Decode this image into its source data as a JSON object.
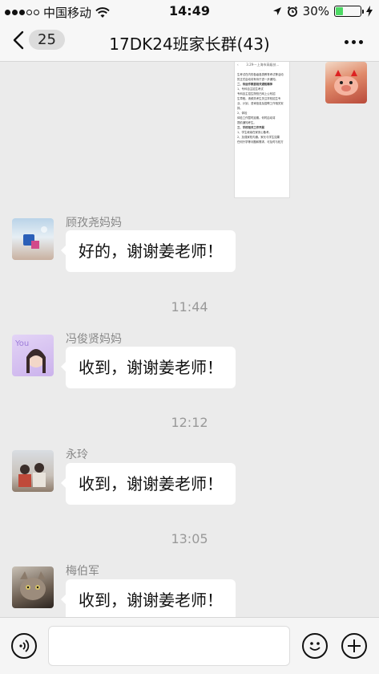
{
  "status_bar": {
    "carrier": "中国移动",
    "time": "14:49",
    "battery_percent": "30%",
    "battery_level": 0.3
  },
  "nav": {
    "back_count": "25",
    "title": "17DK24班家长群(43)"
  },
  "document_preview": {
    "header": "3.29---上海市高级技...",
    "lines": [
      "生考试在内的各级各类教育考试等活动",
      "的正式启动将有待于进一步通知。",
      "二、待运作教委相关通知精神",
      "1、专科自主招生考试",
      "专科自主招生院校已网上公布招",
      "生章程。请频关考生关注学校招生专",
      "业、计划、咨询信息及招聘工作相关安",
      "排。",
      "2、体检",
      "体检工作暂时延期。何时启动将",
      "提前通知考生。",
      "三、学校相关工作开展",
      "1、学生继续在家安心备考。",
      "2、加强家校沟通。家长与学生如果",
      "任何升学等问题和需求，可及时与校方"
    ]
  },
  "messages": [
    {
      "sender": "顾孜尧妈妈",
      "text": "好的，谢谢姜老师！"
    },
    {
      "timestamp": "11:44"
    },
    {
      "sender": "冯俊贤妈妈",
      "text": "收到，谢谢姜老师！"
    },
    {
      "timestamp": "12:12"
    },
    {
      "sender": "永玲",
      "text": "收到，谢谢姜老师！"
    },
    {
      "timestamp": "13:05"
    },
    {
      "sender": "梅伯军",
      "text": "收到，谢谢姜老师！"
    }
  ],
  "avatar_label": "You",
  "icons": {
    "wifi": "wifi-icon",
    "location": "location-arrow-icon",
    "alarm": "alarm-clock-icon",
    "charging": "bolt-icon",
    "back": "chevron-left-icon",
    "more": "ellipsis-icon",
    "voice": "voice-icon",
    "emoji": "emoji-icon",
    "add": "plus-icon"
  },
  "colors": {
    "chat_background": "#ebebeb",
    "bubble": "#ffffff",
    "battery_fill": "#4cd964",
    "timestamp_text": "#999999"
  }
}
